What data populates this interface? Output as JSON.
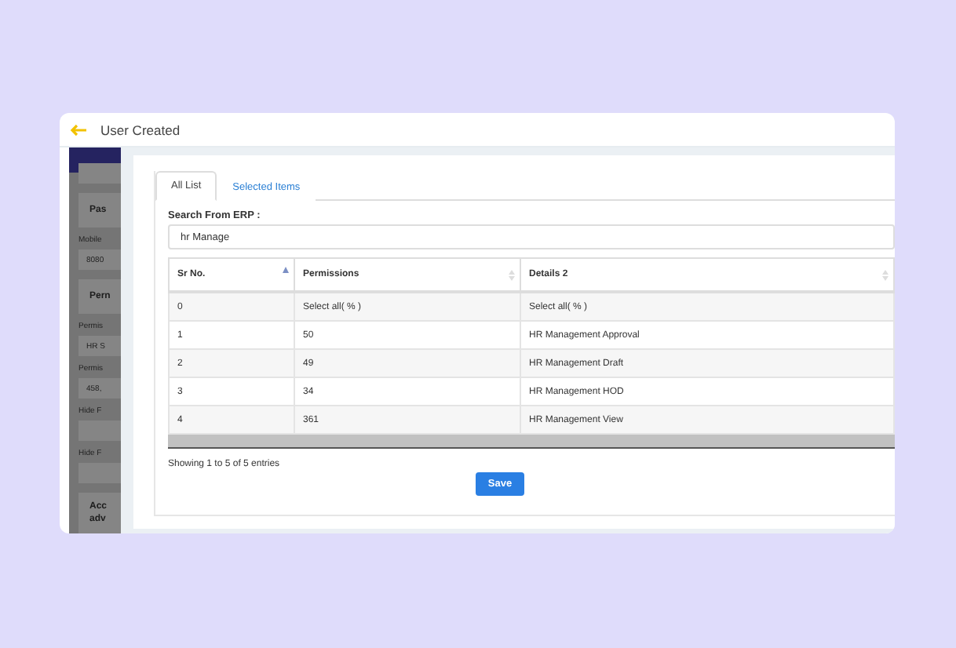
{
  "header": {
    "title": "User Created"
  },
  "background_form": [
    {
      "kind": "field"
    },
    {
      "kind": "button",
      "text": "Pas"
    },
    {
      "kind": "label",
      "text": "Mobile"
    },
    {
      "kind": "field",
      "text": "8080"
    },
    {
      "kind": "button",
      "text": "Pern"
    },
    {
      "kind": "label",
      "text": "Permis"
    },
    {
      "kind": "field",
      "text": "HR S"
    },
    {
      "kind": "label",
      "text": "Permis"
    },
    {
      "kind": "field",
      "text": "458,"
    },
    {
      "kind": "label",
      "text": "Hide F"
    },
    {
      "kind": "field"
    },
    {
      "kind": "label",
      "text": "Hide F"
    },
    {
      "kind": "field"
    },
    {
      "kind": "button",
      "text": "Acc adv"
    }
  ],
  "tabs": [
    {
      "label": "All List",
      "selected": true
    },
    {
      "label": "Selected Items",
      "selected": false
    }
  ],
  "search": {
    "label": "Search From ERP :",
    "value": "hr Manage"
  },
  "table": {
    "columns": [
      {
        "label": "Sr No.",
        "sorted": true
      },
      {
        "label": "Permissions",
        "sorted": false
      },
      {
        "label": "Details 2",
        "sorted": false
      }
    ],
    "rows": [
      [
        "0",
        "Select all( % )",
        "Select all( % )"
      ],
      [
        "1",
        "50",
        "HR Management Approval"
      ],
      [
        "2",
        "49",
        "HR Management Draft"
      ],
      [
        "3",
        "34",
        "HR Management HOD"
      ],
      [
        "4",
        "361",
        "HR Management View"
      ]
    ]
  },
  "info": "Showing 1 to 5 of 5 entries",
  "save_button": "Save"
}
